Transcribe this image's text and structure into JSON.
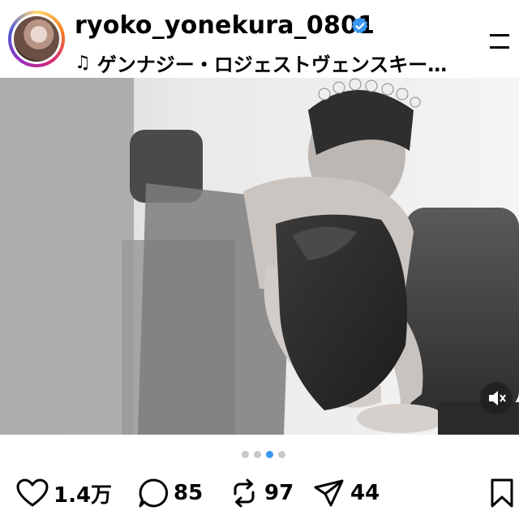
{
  "header": {
    "username": "ryoko_yonekura_0801",
    "music_title": "ゲンナジー・ロジェストヴェンスキー…"
  },
  "photo": {
    "description_icon": "photo"
  },
  "pagination": {
    "count": 4,
    "active_index": 2
  },
  "actions": {
    "likes": "1.4万",
    "comments": "85",
    "reposts": "97",
    "shares": "44"
  },
  "colors": {
    "verified": "#3897f0",
    "active_dot": "#3897f0"
  }
}
